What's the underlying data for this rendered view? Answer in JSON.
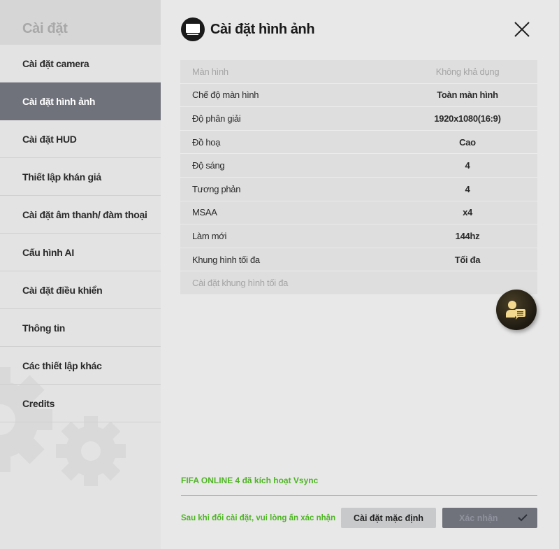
{
  "sidebar": {
    "title": "Cài đặt",
    "items": [
      {
        "label": "Cài đặt camera"
      },
      {
        "label": "Cài đặt hình ảnh",
        "active": true
      },
      {
        "label": "Cài đặt HUD"
      },
      {
        "label": "Thiết lập khán giả"
      },
      {
        "label": "Cài đặt âm thanh/ đàm thoại"
      },
      {
        "label": "Cấu hình AI"
      },
      {
        "label": "Cài đặt điều khiển"
      },
      {
        "label": "Thông tin"
      },
      {
        "label": "Các thiết lập khác"
      },
      {
        "label": "Credits"
      }
    ]
  },
  "header": {
    "title": "Cài đặt hình ảnh",
    "icon": "monitor-icon"
  },
  "settings": [
    {
      "key": "Màn hình",
      "value": "Không khả dụng",
      "disabled": true
    },
    {
      "key": "Chế độ màn hình",
      "value": "Toàn màn hình"
    },
    {
      "key": "Độ phân giải",
      "value": "1920x1080(16:9)"
    },
    {
      "key": "Đồ hoạ",
      "value": "Cao"
    },
    {
      "key": "Độ sáng",
      "value": "4"
    },
    {
      "key": "Tương phản",
      "value": "4"
    },
    {
      "key": "MSAA",
      "value": "x4"
    },
    {
      "key": "Làm mới",
      "value": "144hz"
    },
    {
      "key": "Khung hình tối đa",
      "value": "Tối đa"
    },
    {
      "key": "Cài đặt khung hình tối đa",
      "value": "",
      "disabled": true
    }
  ],
  "footer": {
    "vsync_notice": "FIFA ONLINE 4 đã kích hoạt Vsync",
    "hint": "Sau khi đổi cài đặt, vui lòng ấn xác nhận",
    "default_label": "Cài đặt mặc định",
    "confirm_label": "Xác nhận"
  },
  "colors": {
    "accent_green": "#4fb524",
    "active_item": "#6f717b"
  }
}
